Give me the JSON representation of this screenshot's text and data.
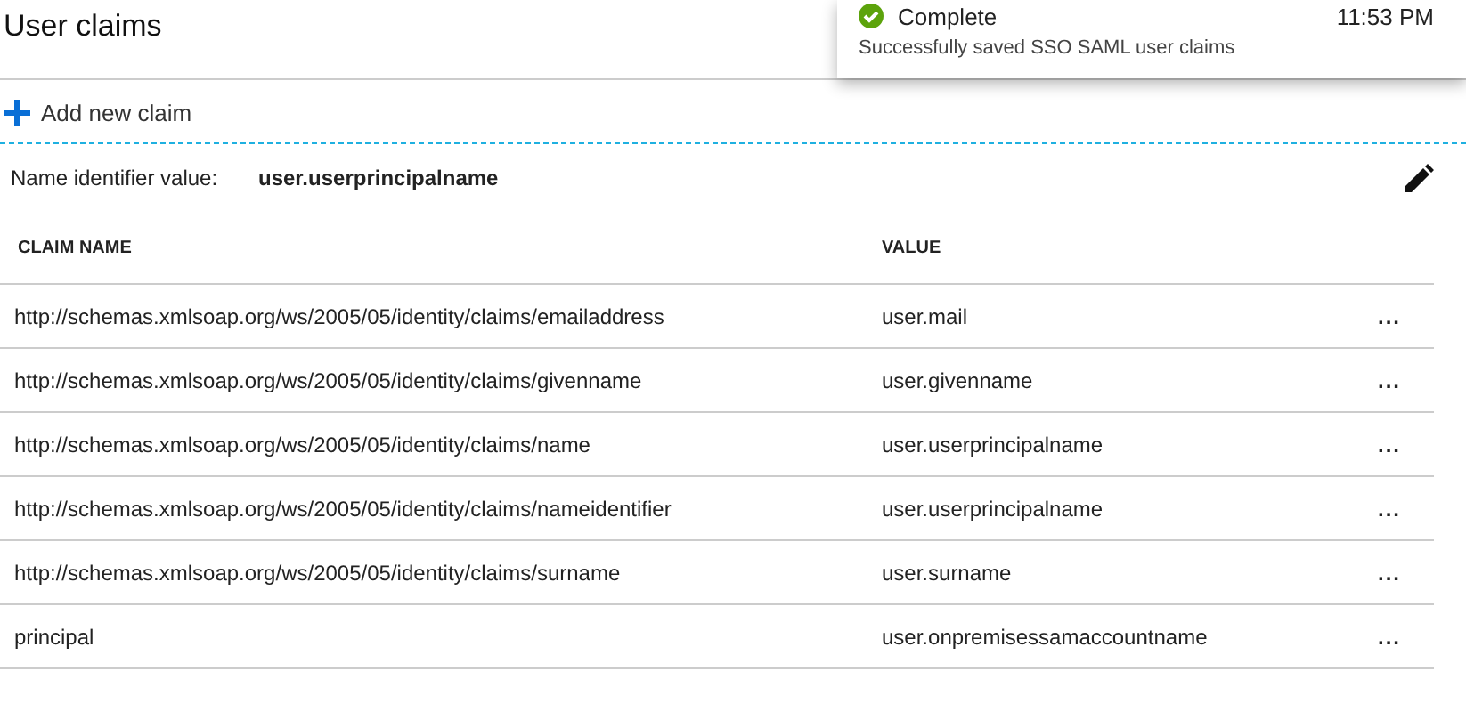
{
  "title": "User claims",
  "toast": {
    "status": "Complete",
    "time": "11:53 PM",
    "message": "Successfully saved SSO SAML user claims"
  },
  "add_button": "Add new claim",
  "name_identifier": {
    "label": "Name identifier value:",
    "value": "user.userprincipalname"
  },
  "table": {
    "columns": [
      "CLAIM NAME",
      "VALUE"
    ],
    "rows": [
      {
        "claim_name": "http://schemas.xmlsoap.org/ws/2005/05/identity/claims/emailaddress",
        "value": "user.mail",
        "menu": "..."
      },
      {
        "claim_name": "http://schemas.xmlsoap.org/ws/2005/05/identity/claims/givenname",
        "value": "user.givenname",
        "menu": "..."
      },
      {
        "claim_name": "http://schemas.xmlsoap.org/ws/2005/05/identity/claims/name",
        "value": "user.userprincipalname",
        "menu": "..."
      },
      {
        "claim_name": "http://schemas.xmlsoap.org/ws/2005/05/identity/claims/nameidentifier",
        "value": "user.userprincipalname",
        "menu": "..."
      },
      {
        "claim_name": "http://schemas.xmlsoap.org/ws/2005/05/identity/claims/surname",
        "value": "user.surname",
        "menu": "..."
      },
      {
        "claim_name": "principal",
        "value": "user.onpremisessamaccountname",
        "menu": "..."
      }
    ]
  }
}
